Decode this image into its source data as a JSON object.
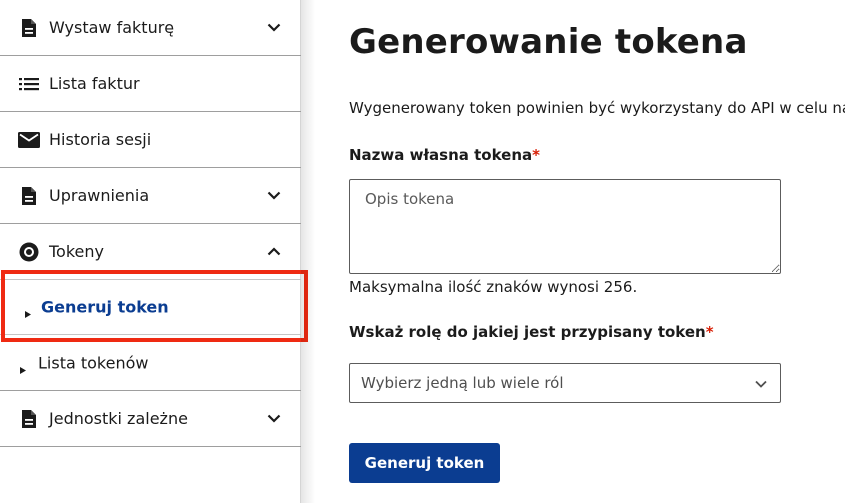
{
  "sidebar": {
    "items": [
      {
        "label": "Wystaw fakturę",
        "icon": "document-icon",
        "chevron": "down"
      },
      {
        "label": "Lista faktur",
        "icon": "list-icon"
      },
      {
        "label": "Historia sesji",
        "icon": "envelope-icon"
      },
      {
        "label": "Uprawnienia",
        "icon": "document-icon",
        "chevron": "down"
      },
      {
        "label": "Tokeny",
        "icon": "disc-icon",
        "chevron": "up"
      },
      {
        "label": "Jednostki zależne",
        "icon": "document-icon",
        "chevron": "down"
      }
    ],
    "sub_items": [
      {
        "label": "Generuj token",
        "active": true
      },
      {
        "label": "Lista tokenów",
        "active": false
      }
    ]
  },
  "main": {
    "title": "Generowanie tokena",
    "description": "Wygenerowany token powinien być wykorzystany do API w celu nawiązania sesji",
    "name_field": {
      "label": "Nazwa własna tokena",
      "required_mark": "*",
      "placeholder": "Opis tokena",
      "hint": "Maksymalna ilość znaków wynosi 256."
    },
    "role_field": {
      "label": "Wskaż rolę do jakiej jest przypisany token",
      "required_mark": "*",
      "placeholder": "Wybierz jedną lub wiele ról"
    },
    "submit_label": "Generuj token"
  },
  "colors": {
    "primary": "#0b3d91",
    "required": "#d81e05",
    "highlight": "#ef2a12"
  }
}
